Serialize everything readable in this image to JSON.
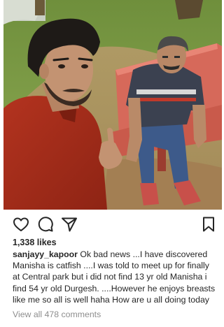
{
  "post": {
    "likes": "1,338 likes",
    "username": "sanjayy_kapoor",
    "caption_lines": [
      " Ok bad news ...I have discovered",
      "Manisha is catfish ....I was told to meet up for finally",
      "at Central park but i did not find 13 yr old Manisha i",
      "find 54 yr old Durgesh. ....However he enjoys breasts",
      "like me so all is well haha How are u all doing today"
    ],
    "view_comments": "View all 478 comments"
  },
  "icons": {
    "like": "heart-icon",
    "comment": "comment-bubble-icon",
    "share": "paper-plane-icon",
    "save": "bookmark-icon"
  },
  "colors": {
    "text": "#262626",
    "muted": "#8e8e8e",
    "icon": "#262626"
  }
}
